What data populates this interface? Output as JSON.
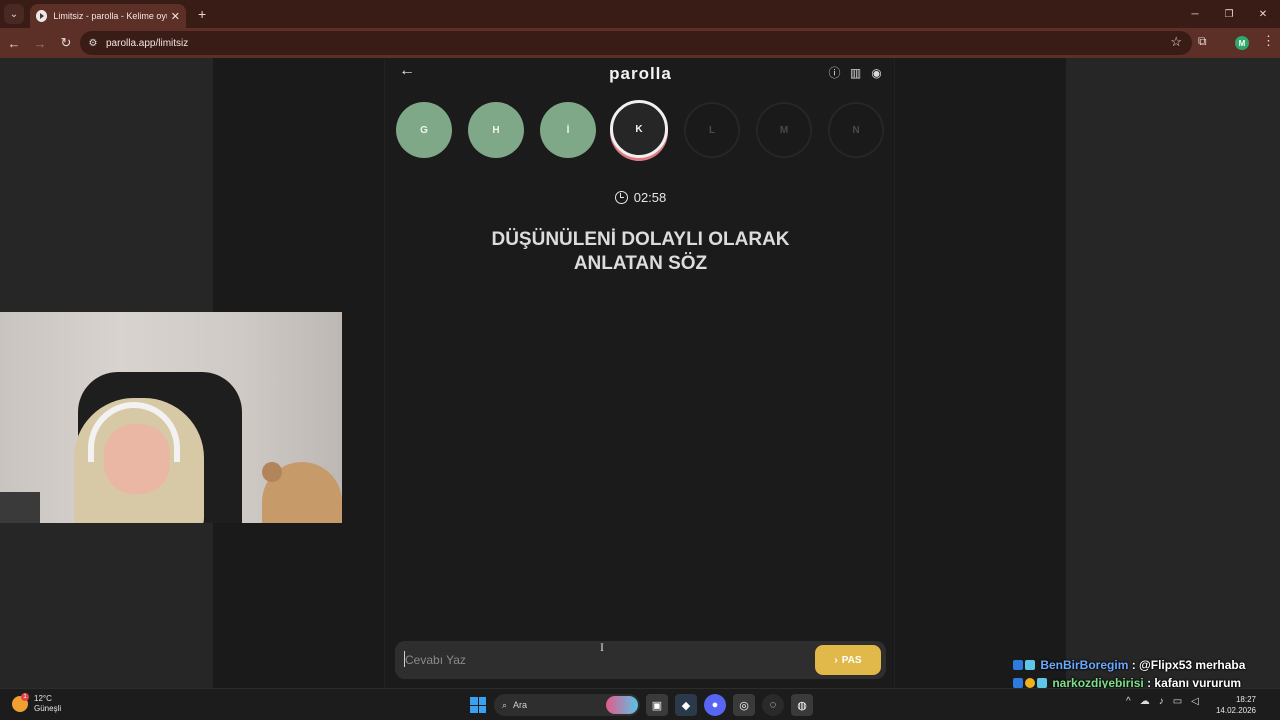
{
  "browser": {
    "tab_title": "Limitsiz - parolla - Kelime oyunu",
    "url": "parolla.app/limitsiz",
    "profile_initial": "M"
  },
  "app": {
    "logo": "parolla",
    "letters": [
      {
        "label": "G",
        "state": "done"
      },
      {
        "label": "H",
        "state": "done"
      },
      {
        "label": "İ",
        "state": "done"
      },
      {
        "label": "K",
        "state": "active"
      },
      {
        "label": "L",
        "state": "pending"
      },
      {
        "label": "M",
        "state": "pending"
      },
      {
        "label": "N",
        "state": "pending"
      }
    ],
    "timer": "02:58",
    "question_line1": "DÜŞÜNÜLENİ DOLAYLI OLARAK",
    "question_line2": "ANLATAN SÖZ",
    "answer_placeholder": "Cevabı Yaz",
    "pas_label": "PAS"
  },
  "chat": [
    {
      "user": "BenBirBoregim",
      "message": ": @Flipx53 merhaba"
    },
    {
      "user": "narkozdiyebirisi",
      "message": ": kafanı vururum senin git ötede ağla"
    }
  ],
  "taskbar": {
    "weather_temp": "12°C",
    "weather_desc": "Güneşli",
    "weather_badge": "1",
    "search_label": "Ara",
    "time": "18:27",
    "date": "14.02.2026"
  },
  "colors": {
    "done_letter": "#7ea888",
    "active_ring": "#e07b82",
    "pas_button": "#e1b84a",
    "browser_frame": "#5c2f27"
  }
}
